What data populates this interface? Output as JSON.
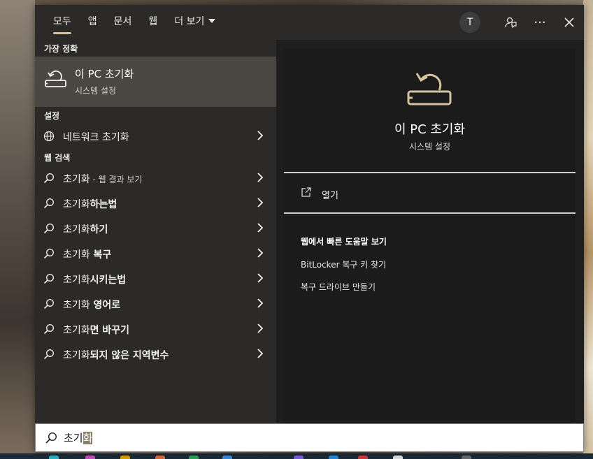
{
  "tabs": [
    {
      "label": "모두",
      "active": true
    },
    {
      "label": "앱"
    },
    {
      "label": "문서"
    },
    {
      "label": "웹"
    },
    {
      "label": "더 보기"
    }
  ],
  "header": {
    "avatar_letter": "T",
    "more_glyph": "···"
  },
  "best_match": {
    "section": "가장 정확",
    "title": "이 PC 초기화",
    "subtitle": "시스템 설정"
  },
  "settings": {
    "section": "설정",
    "items": [
      {
        "label": "네트워크 초기화",
        "icon": "globe-icon"
      }
    ]
  },
  "web": {
    "section": "웹 검색",
    "first": {
      "prefix": "초기화",
      "suffix": " - 웹 결과 보기"
    },
    "items": [
      {
        "normal": "초기화",
        "bold": "하는법"
      },
      {
        "normal": "초기화",
        "bold": "하기"
      },
      {
        "normal": "초기화",
        "bold": " 복구"
      },
      {
        "normal": "초기화",
        "bold": "시키는법"
      },
      {
        "normal": "초기화",
        "bold": " 영어로"
      },
      {
        "normal": "초기화",
        "bold": "면 바꾸기"
      },
      {
        "normal": "초기화",
        "bold": "되지 않은 지역변수"
      }
    ]
  },
  "preview": {
    "title": "이 PC 초기화",
    "subtitle": "시스템 설정",
    "open_label": "열기",
    "help_heading": "웹에서 빠른 도움말 보기",
    "help_links": [
      "BitLocker 복구 키 찾기",
      "복구 드라이브 만들기"
    ]
  },
  "search": {
    "value_plain": "초기",
    "value_selected": "화"
  },
  "colors": {
    "accent": "#d6c29c",
    "panel": "#2b2a28",
    "highlight": "#4a4641"
  }
}
